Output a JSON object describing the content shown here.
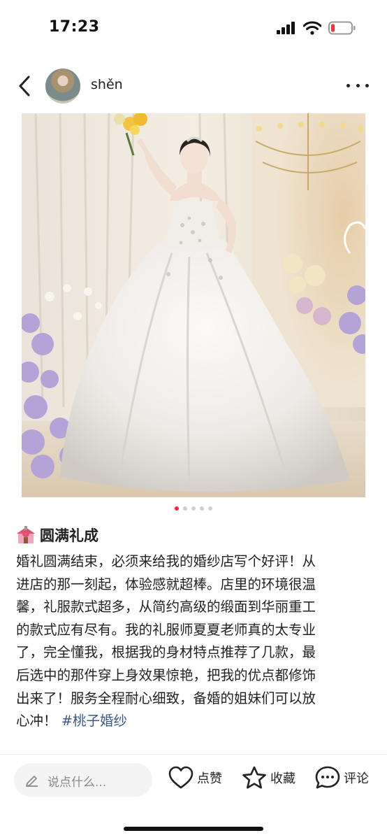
{
  "status_bar": {
    "time": "17:23"
  },
  "header": {
    "username": "shěn"
  },
  "post": {
    "image_count": 5,
    "active_image_index": 0,
    "title_emoji": "💒",
    "title": "圆满礼成",
    "body_lines": [
      "婚礼圆满结束，必须来给我的婚纱店写个好评！从",
      "进店的那一刻起，体验感就超棒。店里的环境很温",
      "馨，礼服款式超多，从简约高级的缎面到华丽重工",
      "的款式应有尽有。我的礼服师夏夏老师真的太专业",
      "了，完全懂我，根据我的身材特点推荐了几款，最",
      "后选中的那件穿上身效果惊艳，把我的优点都修饰",
      "出来了！服务全程耐心细致，备婚的姐妹们可以放"
    ],
    "body_last": "心冲！",
    "hashtag": "#桃子婚纱"
  },
  "bottom_bar": {
    "comment_placeholder": "说点什么...",
    "like_label": "点赞",
    "collect_label": "收藏",
    "comment_label": "评论"
  },
  "colors": {
    "accent": "#ff2442",
    "hashtag": "#3d5a8c"
  }
}
